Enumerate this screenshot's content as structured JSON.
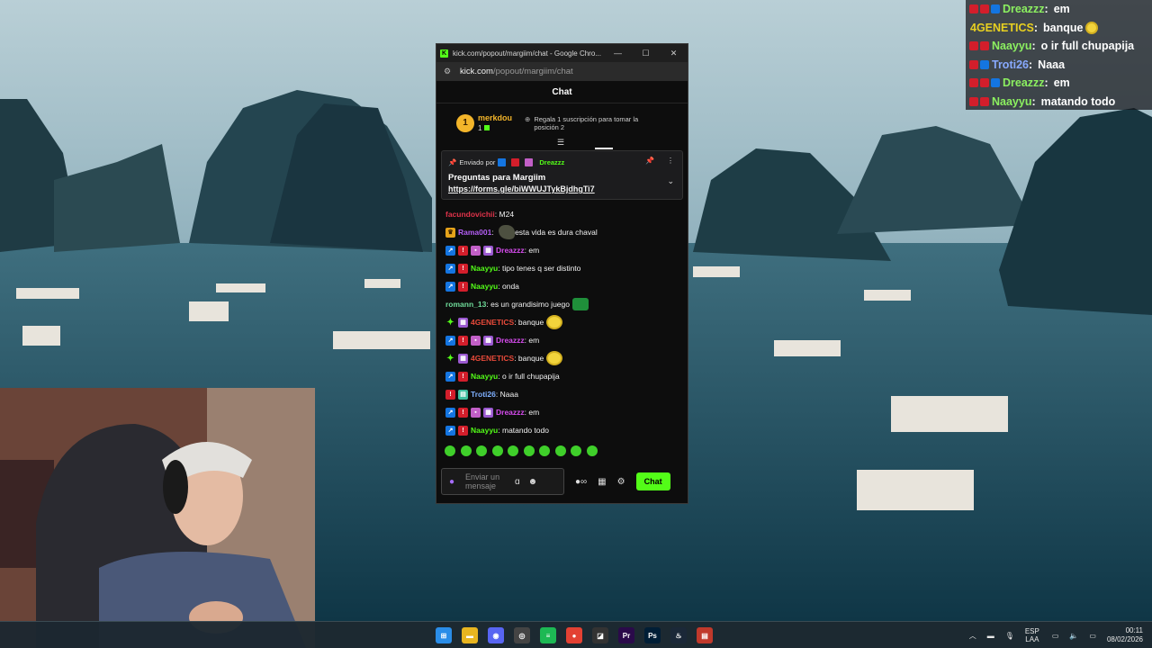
{
  "overlay_chat": [
    {
      "badges": [
        "og",
        "og",
        "vip"
      ],
      "name": "Dreazzz",
      "name_color": "#8cf060",
      "message": "em"
    },
    {
      "badges": [],
      "name": "4GENETICS",
      "name_color": "#e8d020",
      "message": "banque",
      "emote": "face-icon"
    },
    {
      "badges": [
        "og",
        "og"
      ],
      "name": "Naayyu",
      "name_color": "#8cf060",
      "message": "o ir full chupapija"
    },
    {
      "badges": [
        "og",
        "vip"
      ],
      "name": "Troti26",
      "name_color": "#88aaff",
      "message": "Naaa"
    },
    {
      "badges": [
        "og",
        "og",
        "vip"
      ],
      "name": "Dreazzz",
      "name_color": "#8cf060",
      "message": "em"
    },
    {
      "badges": [
        "og",
        "og"
      ],
      "name": "Naayyu",
      "name_color": "#8cf060",
      "message": "matando todo"
    }
  ],
  "browser": {
    "title": "kick.com/popout/margiim/chat - Google Chro...",
    "url_domain": "kick.com",
    "url_path": "/popout/margiim/chat",
    "minimize": "—",
    "maximize": "☐",
    "close": "✕"
  },
  "chat": {
    "header": "Chat",
    "top_supporter": {
      "rank": "1",
      "name": "merkdou",
      "count": "1",
      "gift_text": "Regala 1 suscripción para tomar la posición 2"
    },
    "pinned": {
      "sent_by_label": "Enviado por",
      "sent_by_name": "Dreazzz",
      "title": "Preguntas para Margiim",
      "link": "https://forms.gle/biWWUJTykBjdhgTi7"
    },
    "messages": [
      {
        "badges": [],
        "name": "facundovichii",
        "color": "#e0334a",
        "text": "M24"
      },
      {
        "badges": [
          "crown"
        ],
        "name": "Rama001",
        "color": "#b45ef5",
        "text": "esta vida es dura chaval",
        "emote": "fist"
      },
      {
        "badges": [
          "vip",
          "og",
          "gift",
          "sub"
        ],
        "name": "Dreazzz",
        "color": "#d84cf0",
        "text": "em"
      },
      {
        "badges": [
          "vip",
          "og"
        ],
        "name": "Naayyu",
        "color": "#53fc18",
        "text": "tipo tenes q ser distinto"
      },
      {
        "badges": [
          "vip",
          "og"
        ],
        "name": "Naayyu",
        "color": "#53fc18",
        "text": "onda"
      },
      {
        "badges": [],
        "name": "romann_13",
        "color": "#6fdc9a",
        "text": "es un grandisimo juego",
        "emote": "box"
      },
      {
        "badges": [
          "star",
          "sub"
        ],
        "name": "4GENETICS",
        "color": "#e84a3a",
        "text": "banque",
        "emote": "face"
      },
      {
        "badges": [
          "vip",
          "og",
          "gift",
          "sub"
        ],
        "name": "Dreazzz",
        "color": "#d84cf0",
        "text": "em"
      },
      {
        "badges": [
          "star",
          "sub"
        ],
        "name": "4GENETICS",
        "color": "#e84a3a",
        "text": "banque",
        "emote": "face"
      },
      {
        "badges": [
          "vip",
          "og"
        ],
        "name": "Naayyu",
        "color": "#53fc18",
        "text": "o ir full chupapija"
      },
      {
        "badges": [
          "og",
          "tm"
        ],
        "name": "Troti26",
        "color": "#7fb0ff",
        "text": "Naaa"
      },
      {
        "badges": [
          "vip",
          "og",
          "gift",
          "sub"
        ],
        "name": "Dreazzz",
        "color": "#d84cf0",
        "text": "em"
      },
      {
        "badges": [
          "vip",
          "og"
        ],
        "name": "Naayyu",
        "color": "#53fc18",
        "text": "matando todo"
      }
    ],
    "emote_bar_count": 10,
    "input_placeholder": "Enviar un mensaje",
    "send_label": "Chat"
  },
  "taskbar": {
    "icons": [
      "start-icon",
      "file-explorer-icon",
      "discord-icon",
      "obs-icon",
      "spotify-icon",
      "chrome-icon",
      "steam-alt-icon",
      "premiere-icon",
      "photoshop-icon",
      "steam-icon",
      "app-icon"
    ],
    "lang_top": "ESP",
    "lang_bottom": "LAA",
    "time": "00:11",
    "date": "08/02/2026"
  },
  "colors": {
    "kick_green": "#53fc18",
    "chat_bg": "#0d0d0d"
  }
}
